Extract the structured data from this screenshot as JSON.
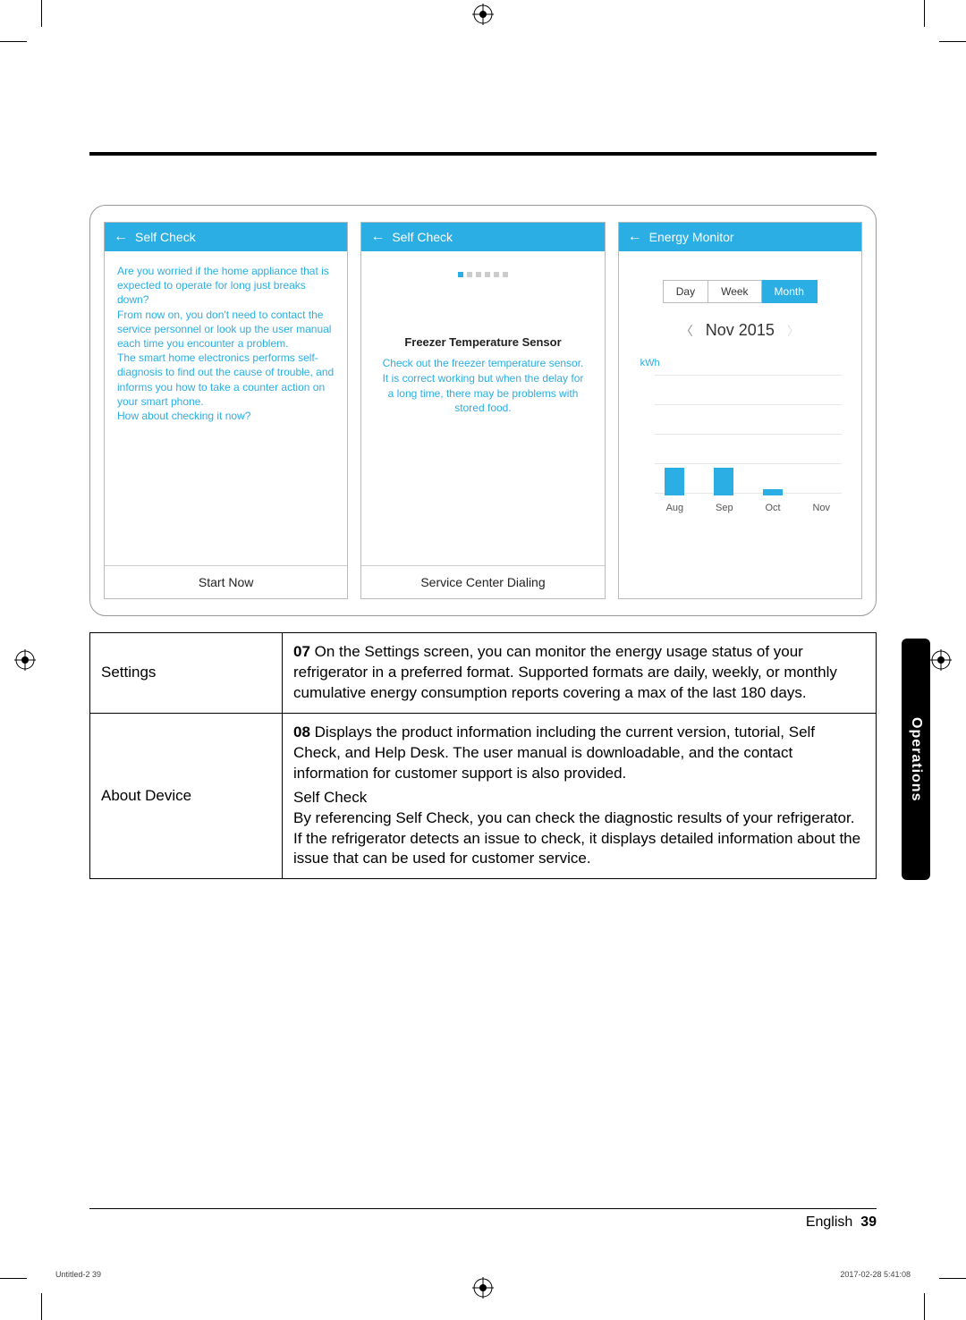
{
  "screens": {
    "left": {
      "title": "Self Check",
      "intro": "Are you worried if the home appliance that is expected to operate for long just breaks down?\nFrom now on, you don't need to contact the service personnel or look up the user manual each time you encounter a problem.\nThe smart home electronics performs self-diagnosis to find out the cause of trouble, and informs you how to take a counter action on your smart phone.\nHow about checking it now?",
      "button": "Start Now"
    },
    "middle": {
      "title": "Self Check",
      "sensor_title": "Freezer Temperature Sensor",
      "sensor_desc": "Check out the freezer temperature sensor. It is correct working but when the delay for a long time, there may be problems with stored food.",
      "button": "Service Center Dialing"
    },
    "right": {
      "title": "Energy Monitor",
      "tabs": {
        "day": "Day",
        "week": "Week",
        "month": "Month"
      },
      "date": "Nov 2015",
      "ylabel": "kWh"
    }
  },
  "chart_data": {
    "type": "bar",
    "title": "",
    "categories": [
      "Aug",
      "Sep",
      "Oct",
      "Nov"
    ],
    "values": [
      22,
      22,
      5,
      0
    ],
    "xlabel": "",
    "ylabel": "kWh",
    "ylim": [
      0,
      100
    ]
  },
  "table": {
    "row1_label": "Settings",
    "row1_num": "07",
    "row1_text": " On the Settings screen, you can monitor the energy usage status of your refrigerator in a preferred format. Supported formats are daily, weekly, or monthly cumulative energy consumption reports covering a max of the last 180 days.",
    "row2_label": "About Device",
    "row2_num": "08",
    "row2_text1": " Displays the product information including the current version, tutorial, Self Check, and Help Desk. The user manual is downloadable, and the contact information for customer support is also provided.",
    "row2_sub": "Self Check",
    "row2_text2": "By referencing Self Check, you can check the diagnostic results of your refrigerator. If the refrigerator detects an issue to check, it displays detailed information about the issue that can be used for customer service."
  },
  "side_tab": "Operations",
  "footer": {
    "lang": "English",
    "page": "39"
  },
  "print": {
    "left": "Untitled-2   39",
    "right": "2017-02-28    5:41:08"
  }
}
